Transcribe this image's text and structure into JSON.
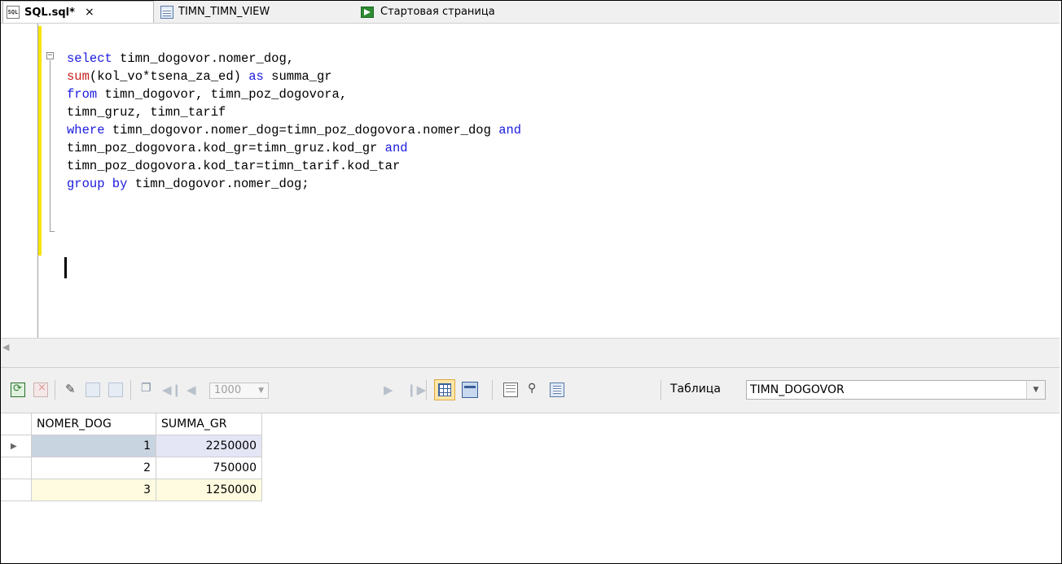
{
  "tabs": [
    {
      "label": "SQL.sql*",
      "close": "×",
      "icon": "sql-file-icon",
      "active": true
    },
    {
      "label": "TIMN_TIMN_VIEW",
      "icon": "table-view-icon"
    },
    {
      "label": "Стартовая страница",
      "icon": "start-page-icon"
    }
  ],
  "editor": {
    "lines": [
      [
        {
          "t": "select ",
          "c": "kw"
        },
        {
          "t": "timn_dogovor.nomer_dog,",
          "c": ""
        }
      ],
      [
        {
          "t": "sum",
          "c": "fn"
        },
        {
          "t": "(kol_vo*tsena_za_ed) ",
          "c": ""
        },
        {
          "t": "as",
          "c": "kw"
        },
        {
          "t": " summa_gr",
          "c": ""
        }
      ],
      [
        {
          "t": "from ",
          "c": "kw"
        },
        {
          "t": "timn_dogovor, timn_poz_dogovora,",
          "c": ""
        }
      ],
      [
        {
          "t": "timn_gruz, timn_tarif",
          "c": ""
        }
      ],
      [
        {
          "t": "where ",
          "c": "kw"
        },
        {
          "t": "timn_dogovor.nomer_dog=timn_poz_dogovora.nomer_dog ",
          "c": ""
        },
        {
          "t": "and",
          "c": "kw"
        }
      ],
      [
        {
          "t": "timn_poz_dogovora.kod_gr=timn_gruz.kod_gr ",
          "c": ""
        },
        {
          "t": "and",
          "c": "kw"
        }
      ],
      [
        {
          "t": "timn_poz_dogovora.kod_tar=timn_tarif.kod_tar",
          "c": ""
        }
      ],
      [
        {
          "t": "group by ",
          "c": "kw"
        },
        {
          "t": "timn_dogovor.nomer_dog;",
          "c": ""
        }
      ]
    ]
  },
  "toolbar": {
    "limit": "1000",
    "table_label": "Таблица",
    "table_value": "TIMN_DOGOVOR"
  },
  "grid": {
    "columns": [
      "NOMER_DOG",
      "SUMMA_GR"
    ],
    "rows": [
      [
        "1",
        "2250000"
      ],
      [
        "2",
        "750000"
      ],
      [
        "3",
        "1250000"
      ]
    ]
  },
  "colors": {
    "keyword": "#1a1ae0",
    "function": "#c81e1e",
    "change_bar": "#f8e400"
  }
}
